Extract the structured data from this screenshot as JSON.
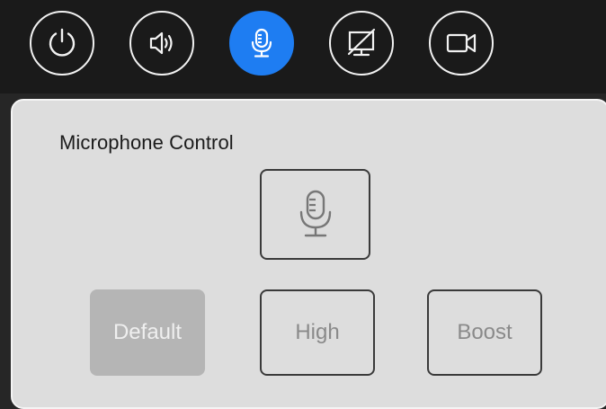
{
  "nav": {
    "items": [
      {
        "icon": "power-icon",
        "active": false
      },
      {
        "icon": "speaker-icon",
        "active": false
      },
      {
        "icon": "microphone-icon",
        "active": true
      },
      {
        "icon": "display-off-icon",
        "active": false
      },
      {
        "icon": "camera-icon",
        "active": false
      }
    ],
    "active_color": "#1e7df2"
  },
  "panel": {
    "title": "Microphone Control",
    "mic_toggle_icon": "microphone-icon",
    "modes": [
      {
        "label": "Default",
        "selected": true
      },
      {
        "label": "High",
        "selected": false
      },
      {
        "label": "Boost",
        "selected": false
      }
    ]
  },
  "colors": {
    "topbar_bg": "#1a1a1a",
    "panel_bg": "#dddddd",
    "selected_mode_bg": "#b5b5b5"
  }
}
